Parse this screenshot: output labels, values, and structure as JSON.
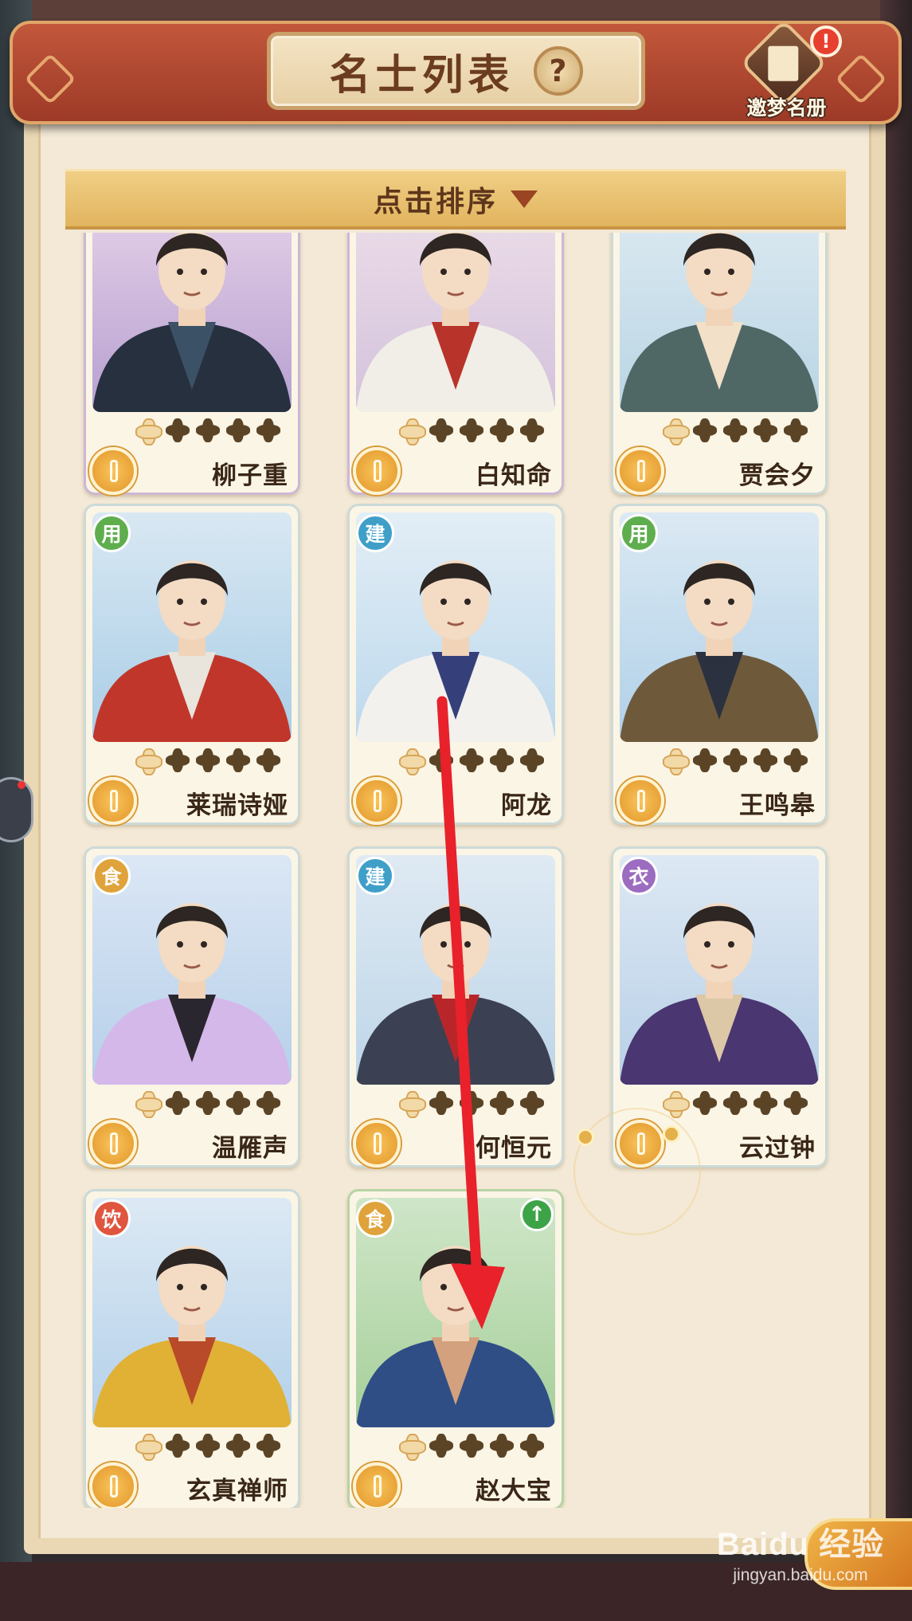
{
  "header": {
    "title": "名士列表",
    "help_icon": "question-icon",
    "roster_label": "邀梦名册",
    "alert_badge": "!"
  },
  "sort": {
    "label": "点击排序",
    "icon": "triangle-down-icon"
  },
  "cards": [
    {
      "name": "柳子重",
      "type": "",
      "filled_stars": 4,
      "total_stars": 5,
      "upgrade": false
    },
    {
      "name": "白知命",
      "type": "",
      "filled_stars": 4,
      "total_stars": 5,
      "upgrade": false
    },
    {
      "name": "贾会夕",
      "type": "",
      "filled_stars": 4,
      "total_stars": 5,
      "upgrade": false
    },
    {
      "name": "莱瑞诗娅",
      "type": "用",
      "filled_stars": 4,
      "total_stars": 5,
      "upgrade": false
    },
    {
      "name": "阿龙",
      "type": "建",
      "filled_stars": 4,
      "total_stars": 5,
      "upgrade": false
    },
    {
      "name": "王鸣皋",
      "type": "用",
      "filled_stars": 4,
      "total_stars": 5,
      "upgrade": false
    },
    {
      "name": "温雁声",
      "type": "食",
      "filled_stars": 4,
      "total_stars": 5,
      "upgrade": false
    },
    {
      "name": "何恒元",
      "type": "建",
      "filled_stars": 4,
      "total_stars": 5,
      "upgrade": false
    },
    {
      "name": "云过钟",
      "type": "衣",
      "filled_stars": 4,
      "total_stars": 5,
      "upgrade": false
    },
    {
      "name": "玄真禅师",
      "type": "饮",
      "filled_stars": 4,
      "total_stars": 5,
      "upgrade": false
    },
    {
      "name": "赵大宝",
      "type": "食",
      "filled_stars": 4,
      "total_stars": 5,
      "upgrade": true
    }
  ],
  "type_colors": {
    "用": "#5fae4e",
    "建": "#3f9fc8",
    "食": "#e0a23a",
    "衣": "#9c6cc0",
    "饮": "#e0553e"
  },
  "watermark": {
    "main": "Baidu 经验",
    "url": "jingyan.baidu.com"
  },
  "annotation": {
    "arrow_color": "#e8212b"
  }
}
